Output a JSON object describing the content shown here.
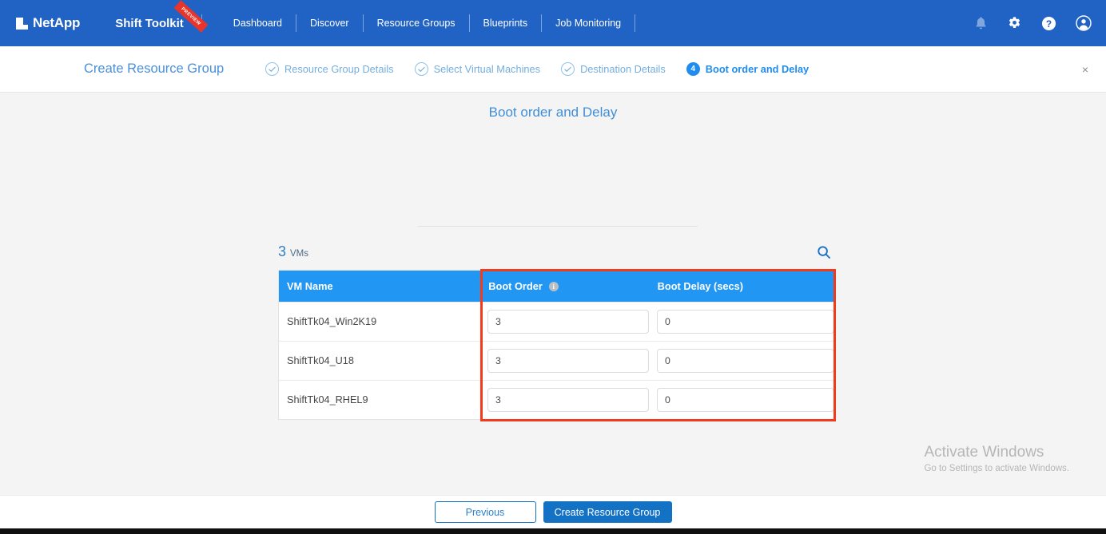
{
  "topnav": {
    "brand": "NetApp",
    "brand_icon": "netapp-logo-mark",
    "product": "Shift Toolkit",
    "product_badge": "PREVIEW",
    "links": [
      {
        "label": "Dashboard"
      },
      {
        "label": "Discover"
      },
      {
        "label": "Resource Groups"
      },
      {
        "label": "Blueprints"
      },
      {
        "label": "Job Monitoring"
      }
    ],
    "icons": [
      {
        "name": "notification-bell-icon"
      },
      {
        "name": "settings-gear-icon"
      },
      {
        "name": "help-question-icon"
      },
      {
        "name": "user-account-icon"
      }
    ],
    "background": "#2063c4"
  },
  "wizard": {
    "title": "Create Resource Group",
    "close_label": "×",
    "steps": [
      {
        "label": "Resource Group Details",
        "state": "complete",
        "marker": "check"
      },
      {
        "label": "Select Virtual Machines",
        "state": "complete",
        "marker": "check"
      },
      {
        "label": "Destination Details",
        "state": "complete",
        "marker": "check"
      },
      {
        "label": "Boot order and Delay",
        "state": "active",
        "marker": "4"
      }
    ],
    "accent": "#1f8cf0"
  },
  "main": {
    "page_title": "Boot order and Delay",
    "vm_count": "3",
    "vm_count_label": "VMs",
    "search_icon": "search-icon",
    "table": {
      "columns": [
        {
          "label": "VM Name",
          "info": false
        },
        {
          "label": "Boot Order",
          "info": true,
          "info_icon": "info-icon"
        },
        {
          "label": "Boot Delay (secs)",
          "info": false
        }
      ],
      "rows": [
        {
          "vm_name": "ShiftTk04_Win2K19",
          "boot_order": "3",
          "boot_delay": "0"
        },
        {
          "vm_name": "ShiftTk04_U18",
          "boot_order": "3",
          "boot_delay": "0"
        },
        {
          "vm_name": "ShiftTk04_RHEL9",
          "boot_order": "3",
          "boot_delay": "0"
        }
      ],
      "header_color": "#2196f3",
      "highlight_color": "#f23a1d"
    }
  },
  "watermark": {
    "line1": "Activate Windows",
    "line2": "Go to Settings to activate Windows."
  },
  "footer": {
    "previous_label": "Previous",
    "submit_label": "Create Resource Group",
    "primary_color": "#1472c4"
  }
}
